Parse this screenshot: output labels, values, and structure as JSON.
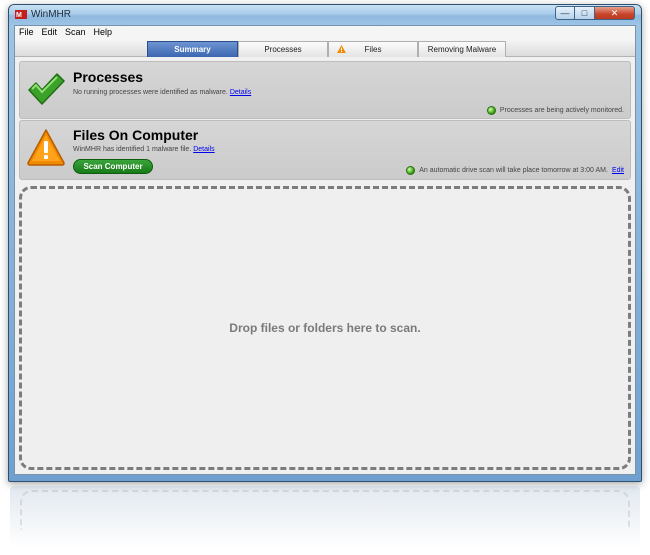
{
  "window": {
    "title": "WinMHR"
  },
  "menu": [
    "File",
    "Edit",
    "Scan",
    "Help"
  ],
  "tabs": [
    {
      "label": "Summary",
      "active": true
    },
    {
      "label": "Processes",
      "active": false
    },
    {
      "label": "Files",
      "active": false,
      "icon": "warning-icon"
    },
    {
      "label": "Removing Malware",
      "active": false
    }
  ],
  "processes": {
    "title": "Processes",
    "description": "No running processes were identified as malware.",
    "link": "Details",
    "status": "Processes are being actively monitored.",
    "icon": "checkmark-icon"
  },
  "files": {
    "title": "Files On Computer",
    "description": "WinMHR has identified 1 malware file.",
    "link": "Details",
    "scan_button": "Scan Computer",
    "status": "An automatic drive scan will take place tomorrow at 3:00 AM.",
    "status_link": "Edit",
    "icon": "warning-icon"
  },
  "dropzone": {
    "text": "Drop files or folders here to scan."
  },
  "colors": {
    "active_tab": "#3b66b0",
    "scan_button": "#177a17",
    "check_green": "#3ca12a",
    "warning_orange": "#f08a00"
  }
}
